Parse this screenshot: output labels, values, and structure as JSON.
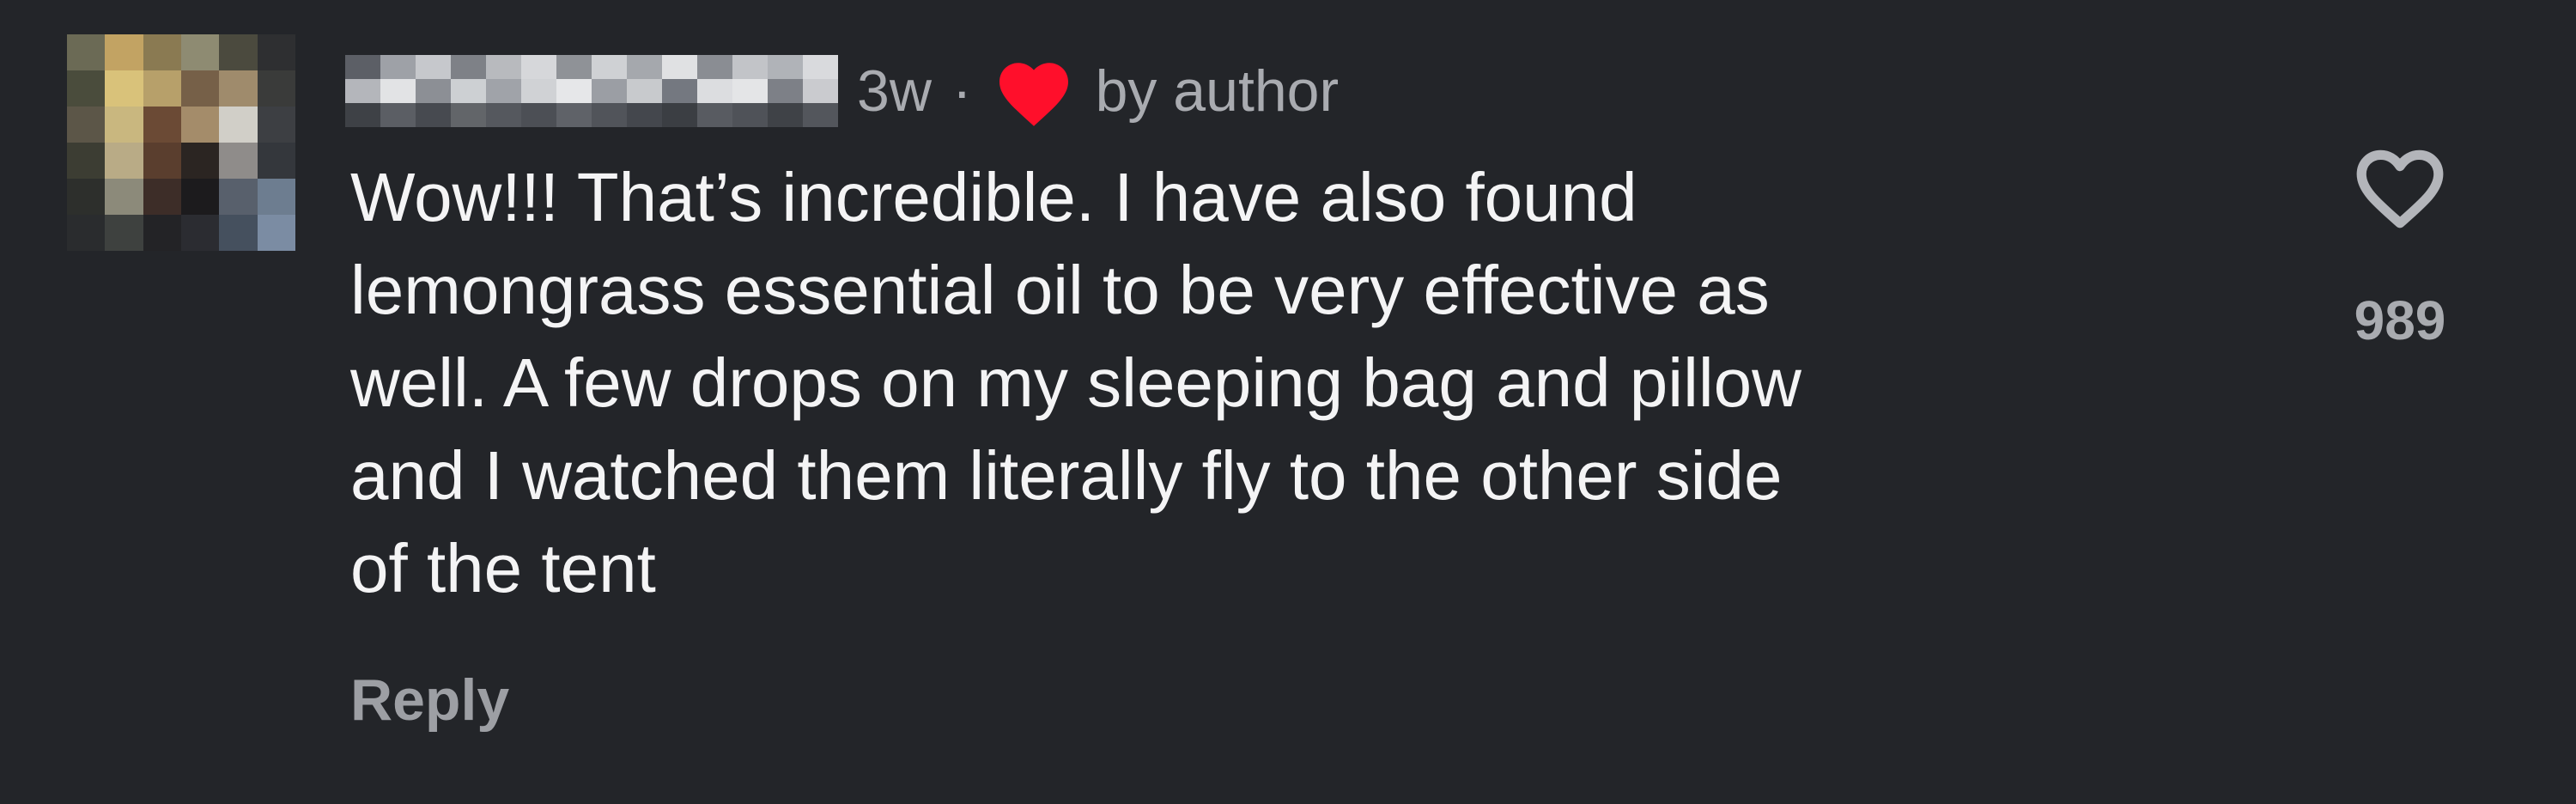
{
  "comment": {
    "time_ago": "3w",
    "separator": "·",
    "liked_by_label": "by author",
    "body": "Wow!!! That’s incredible. I have also found\nlemongrass essential oil to be very effective as\nwell. A few drops on my sleeping bag and pillow\nand I watched them literally fly to the other side\nof the tent",
    "reply_label": "Reply",
    "like_count": "989"
  },
  "icons": {
    "liked_heart": "heart-filled-icon",
    "like_button": "heart-outline-icon"
  },
  "colors": {
    "background": "#232529",
    "text": "#f4f4f5",
    "muted": "#a9abb0",
    "heart": "#ff0f2b"
  }
}
